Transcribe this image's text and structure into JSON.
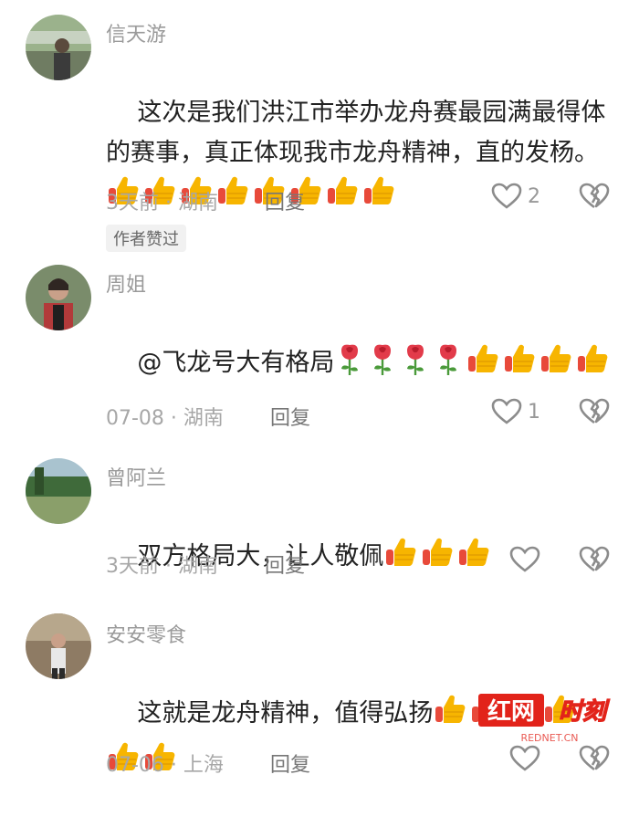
{
  "comments": [
    {
      "author": "信天游",
      "text": "这次是我们洪江市举办龙舟赛最园满最得体的赛事，真正体现我市龙舟精神，直的发杨。",
      "emojis": [
        "thumbs-up-icon",
        "thumbs-up-icon",
        "thumbs-up-icon",
        "thumbs-up-icon",
        "thumbs-up-icon",
        "thumbs-up-icon",
        "thumbs-up-icon",
        "thumbs-up-icon"
      ],
      "meta": "3天前 · 湖南",
      "reply_label": "回复",
      "likes": "2",
      "badge": "作者赞过"
    },
    {
      "author": "周姐",
      "text": "@飞龙号大有格局",
      "emojis": [
        "rose-icon",
        "rose-icon",
        "rose-icon",
        "rose-icon",
        "thumbs-up-icon",
        "thumbs-up-icon",
        "thumbs-up-icon",
        "thumbs-up-icon"
      ],
      "meta": "07-08 · 湖南",
      "reply_label": "回复",
      "likes": "1"
    },
    {
      "author": "曾阿兰",
      "text": "双方格局大，让人敬佩",
      "emojis": [
        "thumbs-up-icon",
        "thumbs-up-icon",
        "thumbs-up-icon"
      ],
      "meta": "3天前 · 湖南",
      "reply_label": "回复",
      "likes": ""
    },
    {
      "author": "安安零食",
      "text": "这就是龙舟精神，值得弘扬",
      "emojis": [
        "thumbs-up-icon",
        "thumbs-up-icon",
        "thumbs-up-icon",
        "thumbs-up-icon",
        "thumbs-up-icon",
        "thumbs-up-icon"
      ],
      "meta": "07-06 · 上海",
      "reply_label": "回复",
      "likes": ""
    }
  ],
  "watermark": {
    "brand": "红网时刻",
    "site": "REDNET.CN"
  },
  "colors": {
    "thumb": "#f7b500",
    "rose": "#e23b4a",
    "watermark": "#e2231a"
  }
}
